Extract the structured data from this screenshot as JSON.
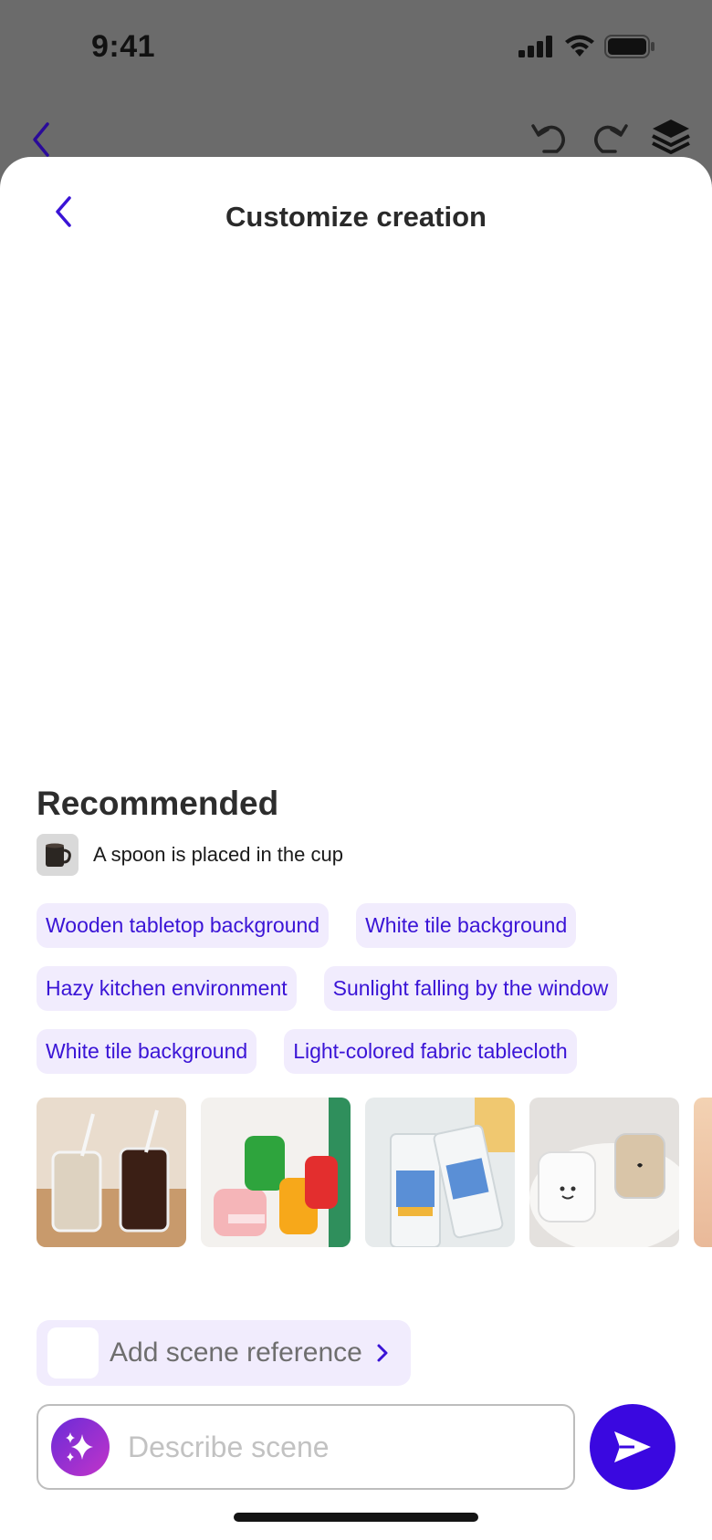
{
  "status_bar": {
    "time": "9:41"
  },
  "background_toolbar": {
    "icons": [
      "chevron-left-icon",
      "undo-icon",
      "redo-icon",
      "layers-icon"
    ]
  },
  "sheet": {
    "title": "Customize creation",
    "recommended": {
      "heading": "Recommended",
      "suggestion": "A spoon is placed in the cup"
    },
    "chips": [
      [
        "Wooden tabletop background",
        "White tile background"
      ],
      [
        "Hazy kitchen environment",
        "Sunlight falling by the window"
      ],
      [
        "White tile background",
        "Light-colored fabric tablecloth"
      ]
    ],
    "scene_reference": {
      "label": "Add scene reference"
    },
    "prompt": {
      "placeholder": "Describe scene"
    }
  },
  "colors": {
    "accent": "#3a08e0",
    "chip_bg": "#f1ecfd",
    "chip_text": "#3a14d6",
    "overlay": "#6b6b6b"
  }
}
